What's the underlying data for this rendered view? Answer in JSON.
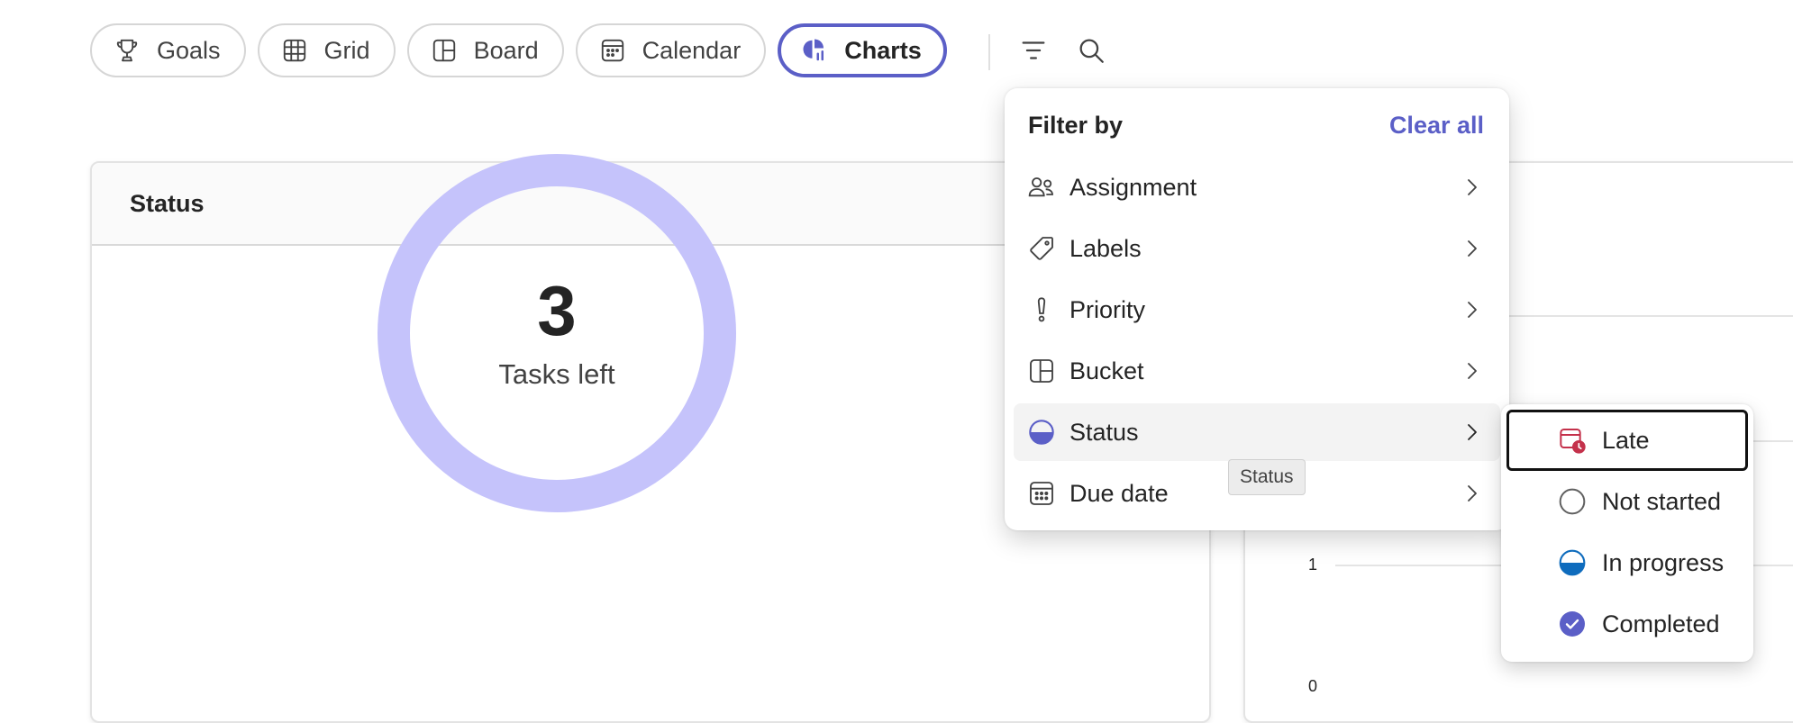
{
  "tabs": [
    {
      "label": "Goals",
      "icon": "trophy-icon",
      "active": false
    },
    {
      "label": "Grid",
      "icon": "grid-icon",
      "active": false
    },
    {
      "label": "Board",
      "icon": "board-icon",
      "active": false
    },
    {
      "label": "Calendar",
      "icon": "calendar-icon",
      "active": false
    },
    {
      "label": "Charts",
      "icon": "charts-icon",
      "active": true
    }
  ],
  "toolbar": {
    "filter_icon": "filter-icon",
    "search_icon": "search-icon"
  },
  "status_card": {
    "title": "Status",
    "count": "3",
    "count_label": "Tasks left"
  },
  "chart_data": {
    "type": "bar",
    "categories": [],
    "series": [],
    "ytick_labels": [
      "1",
      "0"
    ],
    "ylim": [
      0,
      2
    ]
  },
  "filter_menu": {
    "title": "Filter by",
    "clear_all": "Clear all",
    "items": [
      {
        "label": "Assignment",
        "icon": "people-icon"
      },
      {
        "label": "Labels",
        "icon": "tag-icon"
      },
      {
        "label": "Priority",
        "icon": "important-icon"
      },
      {
        "label": "Bucket",
        "icon": "bucket-icon"
      },
      {
        "label": "Status",
        "icon": "status-icon",
        "hovered": true
      },
      {
        "label": "Due date",
        "icon": "calendar-icon"
      }
    ],
    "tooltip": "Status"
  },
  "status_submenu": {
    "items": [
      {
        "label": "Late",
        "icon": "late-calendar-icon",
        "focused": true
      },
      {
        "label": "Not started",
        "icon": "empty-circle-icon"
      },
      {
        "label": "In progress",
        "icon": "half-circle-icon"
      },
      {
        "label": "Completed",
        "icon": "check-circle-icon"
      }
    ]
  },
  "colors": {
    "accent": "#5b5fc7",
    "donut": "#c5c3fb",
    "late": "#c4314b",
    "in_progress": "#0f6cbd",
    "completed": "#5b5fc7"
  }
}
